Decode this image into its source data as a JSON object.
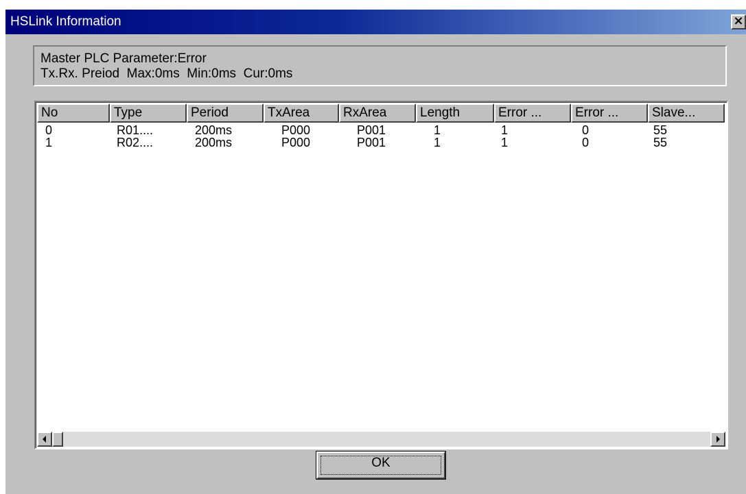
{
  "window": {
    "title": "HSLink Information",
    "close_label": "×"
  },
  "info": {
    "line1": "Master PLC Parameter:Error",
    "line2": "Tx.Rx. Preiod  Max:0ms  Min:0ms  Cur:0ms"
  },
  "table": {
    "columns": [
      "No",
      "Type",
      "Period",
      "TxArea",
      "RxArea",
      "Length",
      "Error ...",
      "Error ...",
      "Slave..."
    ],
    "rows": [
      [
        "0",
        "R01....",
        "200ms",
        "P000",
        "P001",
        "1",
        "1",
        "0",
        "55"
      ],
      [
        "1",
        "R02....",
        "200ms",
        "P000",
        "P001",
        "1",
        "1",
        "0",
        "55"
      ]
    ]
  },
  "buttons": {
    "ok_label": "OK"
  },
  "icons": {
    "close": "close-icon",
    "scroll_left": "arrow-left-icon",
    "scroll_right": "arrow-right-icon"
  },
  "colors": {
    "titlebar_start": "#00007b",
    "titlebar_end": "#7fa4d9",
    "dialog_background": "#c0c0c0"
  }
}
